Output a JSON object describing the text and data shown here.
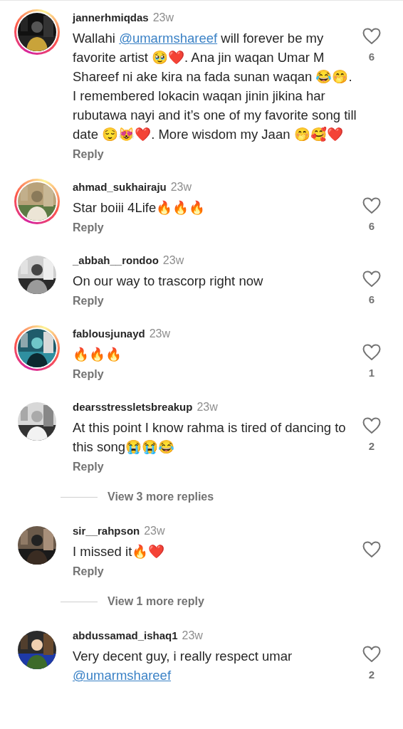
{
  "comments": [
    {
      "username": "jannerhmiqdas",
      "time": "23w",
      "story_ring": true,
      "parts": [
        {
          "kind": "text",
          "text": "Wallahi "
        },
        {
          "kind": "mention",
          "text": "@umarmshareef"
        },
        {
          "kind": "text",
          "text": " will forever be my favorite artist 🥹❤️. Ana jin waqan Umar M Shareef ni ake kira na fada sunan waqan 😂🤭. I remembered lokacin waqan jinin jikina har rubutawa nayi and it’s one of my favorite song till date 😌😻❤️. More wisdom my Jaan 🤭🥰❤️"
        }
      ],
      "reply": "Reply",
      "liked": false,
      "likes": "6"
    },
    {
      "username": "ahmad_sukhairaju",
      "time": "23w",
      "story_ring": true,
      "parts": [
        {
          "kind": "text",
          "text": "Star boiii 4Life🔥🔥🔥"
        }
      ],
      "reply": "Reply",
      "liked": false,
      "likes": "6"
    },
    {
      "username": "_abbah__rondoo",
      "time": "23w",
      "story_ring": false,
      "parts": [
        {
          "kind": "text",
          "text": "On our way to trascorp right now"
        }
      ],
      "reply": "Reply",
      "liked": false,
      "likes": "6"
    },
    {
      "username": "fablousjunayd",
      "time": "23w",
      "story_ring": true,
      "parts": [
        {
          "kind": "text",
          "text": "🔥🔥🔥"
        }
      ],
      "reply": "Reply",
      "liked": false,
      "likes": "1"
    },
    {
      "username": "dearsstressletsbreakup",
      "time": "23w",
      "story_ring": false,
      "parts": [
        {
          "kind": "text",
          "text": "At this point I know rahma is tired of dancing to this song😭😭😂"
        }
      ],
      "reply": "Reply",
      "liked": false,
      "likes": "2",
      "more_replies": "View 3 more replies"
    },
    {
      "username": "sir__rahpson",
      "time": "23w",
      "story_ring": false,
      "parts": [
        {
          "kind": "text",
          "text": "I missed it🔥❤️"
        }
      ],
      "reply": "Reply",
      "liked": false,
      "more_replies": "View 1 more reply"
    },
    {
      "username": "abdussamad_ishaq1",
      "time": "23w",
      "story_ring": false,
      "parts": [
        {
          "kind": "text",
          "text": "Very decent guy, i really respect umar "
        },
        {
          "kind": "mention",
          "text": "@umarmshareef"
        }
      ],
      "liked": false,
      "likes": "2"
    }
  ]
}
